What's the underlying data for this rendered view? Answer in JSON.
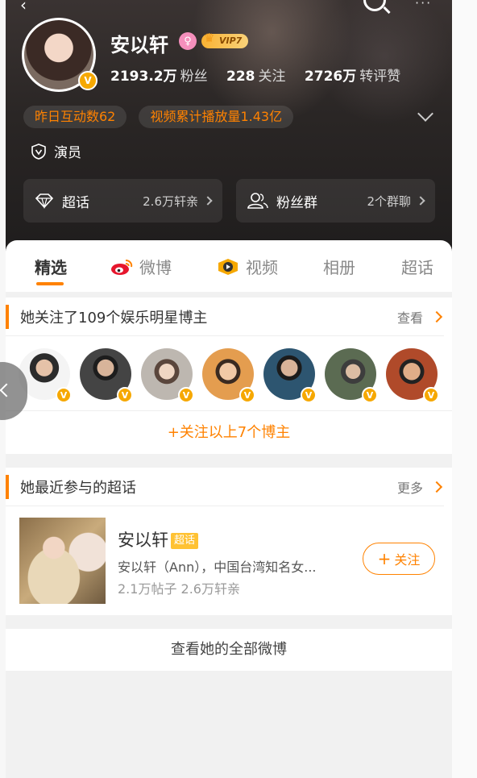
{
  "header": {
    "name": "安以轩",
    "gender_symbol": "♀",
    "vip_label": "VIP7",
    "stats": [
      {
        "value": "2193.2万",
        "label": "粉丝"
      },
      {
        "value": "228",
        "label": "关注"
      },
      {
        "value": "2726万",
        "label": "转评赞"
      }
    ],
    "pills": [
      "昨日互动数62",
      "视频累计播放量1.43亿"
    ],
    "role": "演员",
    "cards": [
      {
        "label": "超话",
        "value": "2.6万轩亲",
        "icon": "diamond-icon"
      },
      {
        "label": "粉丝群",
        "value": "2个群聊",
        "icon": "group-icon"
      }
    ],
    "verified_mark": "V"
  },
  "tabs": [
    {
      "label": "精选",
      "active": true
    },
    {
      "label": "微博",
      "icon": "weibo-icon"
    },
    {
      "label": "视频",
      "icon": "video-play-icon"
    },
    {
      "label": "相册"
    },
    {
      "label": "超话"
    }
  ],
  "following": {
    "title": "她关注了109个娱乐明星博主",
    "link": "查看",
    "follow_all": "+关注以上7个博主"
  },
  "topics": {
    "title": "她最近参与的超话",
    "link": "更多",
    "item": {
      "name": "安以轩",
      "tag": "超话",
      "desc": "安以轩（Ann），中国台湾知名女...",
      "meta": "2.1万帖子 2.6万轩亲",
      "follow_label": "关注"
    }
  },
  "footer": {
    "label": "查看她的全部微博"
  },
  "colors": {
    "accent": "#ff8200",
    "verified": "#f6a800",
    "header_bg": "#2a2625"
  }
}
